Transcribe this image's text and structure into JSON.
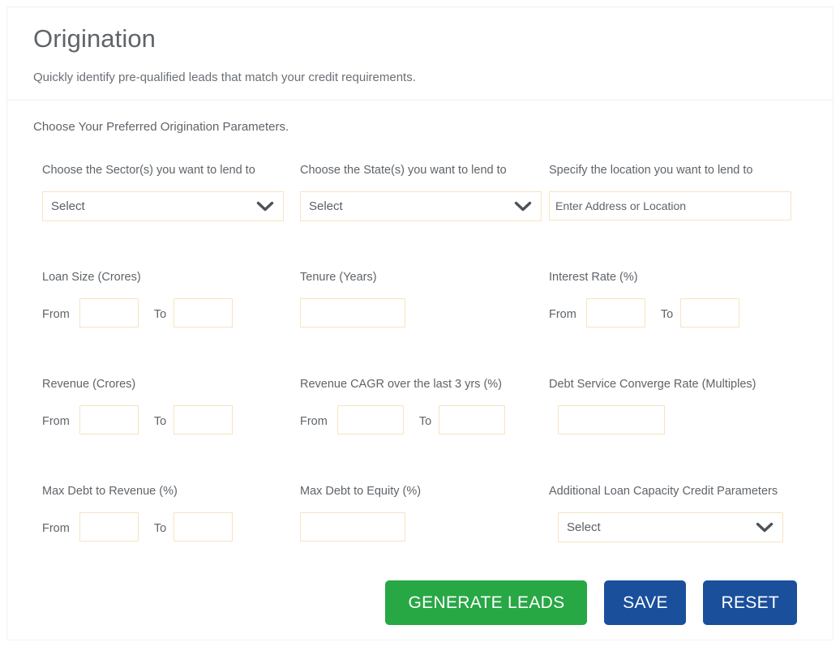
{
  "header": {
    "title": "Origination",
    "subtitle": "Quickly identify pre-qualified leads that match your credit requirements."
  },
  "body": {
    "intro": "Choose Your Preferred Origination Parameters.",
    "range_from_label": "From",
    "range_to_label": "To"
  },
  "fields": {
    "sector": {
      "label": "Choose the Sector(s) you want to lend to",
      "value": "Select",
      "icon": "chevron-down-icon"
    },
    "state": {
      "label": "Choose the State(s) you want to lend to",
      "value": "Select",
      "icon": "chevron-down-icon"
    },
    "location": {
      "label": "Specify the location you want to lend to",
      "value": "",
      "placeholder": "Enter Address or Location"
    },
    "loan_size": {
      "label": "Loan Size (Crores)",
      "from": "",
      "to": ""
    },
    "tenure": {
      "label": "Tenure (Years)",
      "value": ""
    },
    "interest_rate": {
      "label": "Interest Rate (%)",
      "from": "",
      "to": ""
    },
    "revenue": {
      "label": "Revenue (Crores)",
      "from": "",
      "to": ""
    },
    "revenue_cagr": {
      "label": "Revenue CAGR over the last 3 yrs (%)",
      "from": "",
      "to": ""
    },
    "debt_service": {
      "label": "Debt Service Converge Rate (Multiples)",
      "value": ""
    },
    "max_debt_revenue": {
      "label": "Max Debt to Revenue (%)",
      "from": "",
      "to": ""
    },
    "max_debt_equity": {
      "label": "Max Debt to Equity (%)",
      "value": ""
    },
    "additional_params": {
      "label": "Additional Loan Capacity Credit Parameters",
      "value": "Select",
      "icon": "chevron-down-icon"
    }
  },
  "actions": {
    "generate": "GENERATE LEADS",
    "save": "SAVE",
    "reset": "RESET"
  },
  "colors": {
    "green": "#28a745",
    "blue": "#1a4f9c",
    "input_border": "#f7e3c1",
    "text": "#5f6469",
    "card_border": "#f1f1f3"
  }
}
